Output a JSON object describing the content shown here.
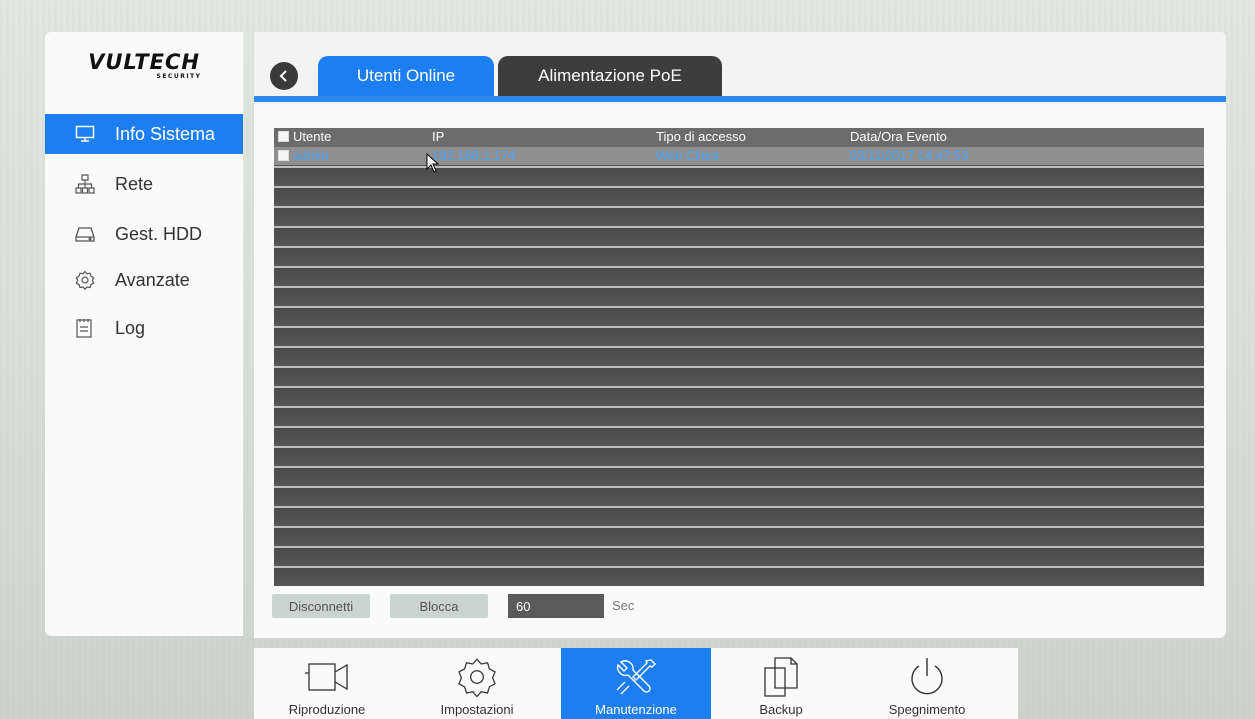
{
  "brand": {
    "logo_text": "VULTECH",
    "logo_sub": "SECURITY"
  },
  "sidebar": {
    "items": [
      {
        "label": "Info Sistema",
        "icon": "monitor-icon",
        "active": true
      },
      {
        "label": "Rete",
        "icon": "network-icon",
        "active": false
      },
      {
        "label": "Gest. HDD",
        "icon": "hdd-icon",
        "active": false
      },
      {
        "label": "Avanzate",
        "icon": "gear-icon",
        "active": false
      },
      {
        "label": "Log",
        "icon": "log-icon",
        "active": false
      }
    ]
  },
  "tabs": [
    {
      "label": "Utenti Online",
      "active": true
    },
    {
      "label": "Alimentazione PoE",
      "active": false
    }
  ],
  "table": {
    "columns": [
      "Utente",
      "IP",
      "Tipo di accesso",
      "Data/Ora Evento"
    ],
    "rows": [
      {
        "utente": "admin",
        "ip": "192.168.1.174",
        "tipo": "Web Client",
        "data": "03/11/2017 14:47:53"
      }
    ]
  },
  "controls": {
    "disconnect_label": "Disconnetti",
    "block_label": "Blocca",
    "timeout_value": "60",
    "timeout_unit": "Sec"
  },
  "dock": {
    "items": [
      {
        "label": "Riproduzione",
        "icon": "camera-icon",
        "active": false
      },
      {
        "label": "Impostazioni",
        "icon": "gear-icon",
        "active": false
      },
      {
        "label": "Manutenzione",
        "icon": "tools-icon",
        "active": true
      },
      {
        "label": "Backup",
        "icon": "backup-icon",
        "active": false
      },
      {
        "label": "Spegnimento",
        "icon": "power-icon",
        "active": false
      }
    ]
  },
  "colors": {
    "accent": "#1c7ef0",
    "row_text": "#4aa5ff"
  }
}
